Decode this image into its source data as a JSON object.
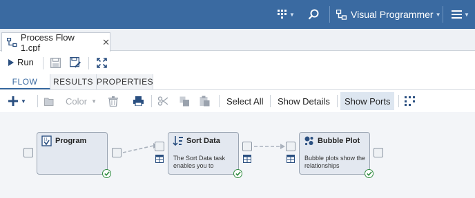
{
  "app": {
    "title": "Visual Programmer",
    "icons": [
      "apps-grid-icon",
      "search-icon",
      "flow-icon",
      "menu-icon"
    ]
  },
  "document_tab": {
    "label": "Process Flow 1.cpf",
    "close_label": "✕"
  },
  "run_toolbar": {
    "run_label": "Run"
  },
  "subtabs": [
    {
      "label": "FLOW",
      "active": true
    },
    {
      "label": "RESULTS",
      "active": false
    },
    {
      "label": "PROPERTIES",
      "active": false
    }
  ],
  "flow_toolbar": {
    "color_label": "Color",
    "select_all_label": "Select All",
    "show_details_label": "Show Details",
    "show_ports_label": "Show Ports"
  },
  "nodes": [
    {
      "title": "Program",
      "description": "",
      "status": "success"
    },
    {
      "title": "Sort Data",
      "description": "The Sort Data task enables you to",
      "status": "success"
    },
    {
      "title": "Bubble Plot",
      "description": "Bubble plots show the relationships",
      "status": "success"
    }
  ],
  "colors": {
    "accent": "#3a6aa1",
    "node_fill": "#e3e8f0",
    "success": "#2e8b3e"
  }
}
